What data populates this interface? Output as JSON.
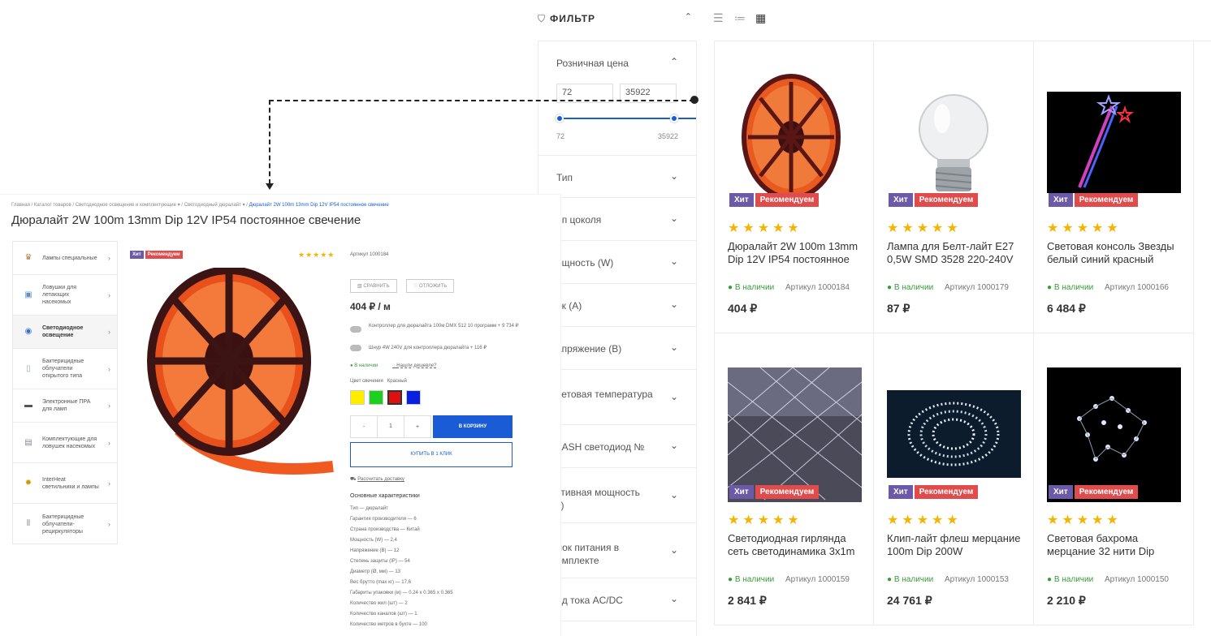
{
  "filter": {
    "title": "ФИЛЬТР",
    "groups": [
      {
        "label": "Розничная цена"
      },
      {
        "label": "Тип"
      },
      {
        "label": "ип цоколя"
      },
      {
        "label": "ощность (W)"
      },
      {
        "label": "ок (A)"
      },
      {
        "label": "апряжение (В)"
      },
      {
        "label": "ветовая температура\n)"
      },
      {
        "label": "LASH светодиод №"
      },
      {
        "label": "ктивная мощность\nт)"
      },
      {
        "label": "лок питания в\nомплекте"
      },
      {
        "label": "ид тока AC/DC"
      }
    ],
    "price_min": "72",
    "price_max": "35922",
    "range_min_label": "72",
    "range_max_label": "35922"
  },
  "products": [
    {
      "name": "Дюралайт 2W 100m 13mm Dip 12V IP54 постоянное",
      "stock": "В наличии",
      "article": "Артикул  1000184",
      "price": "404 ₽",
      "hit": "Хит",
      "rec": "Рекомендуем",
      "stars": "★★★★★"
    },
    {
      "name": "Лампа для Белт-лайт E27 0,5W SMD 3528 220-240V",
      "stock": "В наличии",
      "article": "Артикул  1000179",
      "price": "87 ₽",
      "hit": "Хит",
      "rec": "Рекомендуем",
      "stars": "★★★★★"
    },
    {
      "name": "Световая консоль Звезды белый синий красный",
      "stock": "В наличии",
      "article": "Артикул  1000166",
      "price": "6 484 ₽",
      "hit": "Хит",
      "rec": "Рекомендуем",
      "stars": "★★★★★"
    },
    {
      "name": "Светодиодная гирлянда сеть светодинамика 3x1m",
      "stock": "В наличии",
      "article": "Артикул  1000159",
      "price": "2 841 ₽",
      "hit": "Хит",
      "rec": "Рекомендуем",
      "stars": "★★★★★"
    },
    {
      "name": "Клип-лайт флеш мерцание 100m Dip 200W",
      "stock": "В наличии",
      "article": "Артикул  1000153",
      "price": "24 761 ₽",
      "hit": "Хит",
      "rec": "Рекомендуем",
      "stars": "★★★★★"
    },
    {
      "name": "Световая бахрома мерцание 32 нити Dip",
      "stock": "В наличии",
      "article": "Артикул  1000150",
      "price": "2 210 ₽",
      "hit": "Хит",
      "rec": "Рекомендуем",
      "stars": "★★★★★"
    }
  ],
  "detail": {
    "breadcrumbs": [
      "Главная",
      "Каталог товаров",
      "Светодиодное освещение и комплектующие ▾",
      "Светодиодный дюралайт ▾"
    ],
    "breadcrumb_current": "Дюралайт 2W 100m 13mm Dip 12V IP54 постоянное свечение",
    "title": "Дюралайт 2W 100m 13mm Dip 12V IP54 постоянное свечение",
    "categories": [
      "Лампы специальные",
      "Ловушки для летающих насекомых",
      "Светодиодное освещение",
      "Бактерицидные облучатели открытого типа",
      "Электронные ПРА для ламп",
      "Комплектующие для ловушек насекомых",
      "InterHeat светильники и лампы",
      "Бактерицидные облучатели-рециркуляторы"
    ],
    "hit": "Хит",
    "rec": "Рекомендуем",
    "stars": "★★★★★",
    "article": "Артикул 1000184",
    "compare": "СРАВНИТЬ",
    "defer": "ОТЛОЖИТЬ",
    "price": "404 ₽ / м",
    "option1": "Контроллер для дюралайта 100м DMX 512 10 программ + 9 734 ₽",
    "option2": "Шнур 4W 240V для контроллера дюралайта + 116 ₽",
    "stock": "В наличии",
    "cheaper": "Нашли дешевле?",
    "color_label": "Цвет свечения",
    "color_value": "Красный",
    "qty_minus": "-",
    "qty": "1",
    "qty_plus": "+",
    "cart": "В КОРЗИНУ",
    "one_click": "КУПИТЬ В 1 КЛИК",
    "delivery": "Рассчитать доставку",
    "chars_title": "Основные характеристики",
    "chars": [
      "Тип — дюралайт",
      "Гарантия производителя — 6",
      "Страна производства — Китай",
      "Мощность (W) — 2,4",
      "Напряжение (В) — 12",
      "Степень защиты (IP) — 54",
      "Диаметр (Ø, мм) — 13",
      "Вес брутто (max кг) — 17,6",
      "Габариты упаковки (м) — 0.24 x 0.365 x 0.365",
      "Количество жил (шт) — 2",
      "Количество каналов (шт) — 1",
      "Количество метров в бухте — 100"
    ]
  }
}
